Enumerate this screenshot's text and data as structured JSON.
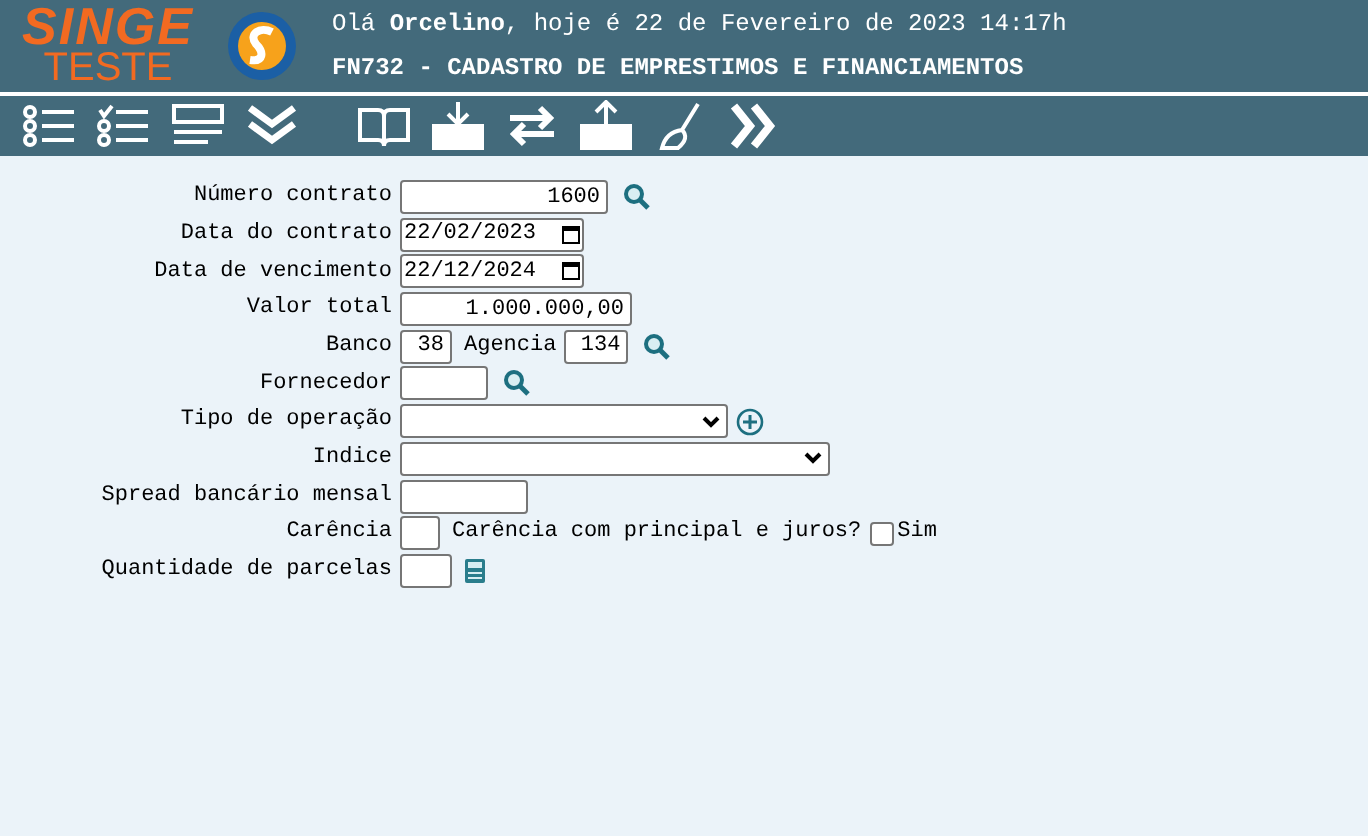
{
  "header": {
    "brand": "SINGE",
    "brand_sub": "TESTE",
    "greeting": "Olá **Orcelino**, hoje é 22 de Fevereiro de 2023 14:17h",
    "title": "FN732 - CADASTRO DE EMPRESTIMOS E FINANCIAMENTOS"
  },
  "form": {
    "rows": [
      {
        "label": "Número contrato",
        "items": [
          {
            "kind": "input",
            "value": "1600"
          },
          {
            "kind": "search"
          }
        ]
      },
      {
        "label": "Data do contrato",
        "items": [
          {
            "kind": "date",
            "value": "22/02/2023"
          }
        ]
      },
      {
        "label": "Data de vencimento",
        "items": [
          {
            "kind": "date",
            "value": "22/12/2024"
          }
        ]
      },
      {
        "label": "Valor total",
        "items": [
          {
            "kind": "input",
            "value": "1.000.000,00"
          }
        ]
      },
      {
        "label": "Banco",
        "items": [
          {
            "kind": "input",
            "value": "38"
          },
          {
            "kind": "label",
            "text": "Agencia"
          },
          {
            "kind": "input",
            "value": "134"
          },
          {
            "kind": "search"
          }
        ]
      },
      {
        "label": "Fornecedor",
        "items": [
          {
            "kind": "input"
          },
          {
            "kind": "search"
          }
        ]
      },
      {
        "label": "Tipo de operação",
        "items": [
          {
            "kind": "select"
          },
          {
            "kind": "add"
          }
        ]
      },
      {
        "label": "Indice",
        "items": [
          {
            "kind": "select"
          }
        ]
      },
      {
        "label": "Spread bancário mensal",
        "items": [
          {
            "kind": "input"
          }
        ]
      },
      {
        "label": "Carência",
        "items": [
          {
            "kind": "input"
          },
          {
            "kind": "label",
            "text": "Carência com principal e juros?"
          },
          {
            "kind": "checkbox",
            "label": "Sim",
            "checked": false
          }
        ]
      },
      {
        "label": "Quantidade de parcelas",
        "items": [
          {
            "kind": "input"
          },
          {
            "kind": "calc"
          }
        ]
      }
    ]
  }
}
